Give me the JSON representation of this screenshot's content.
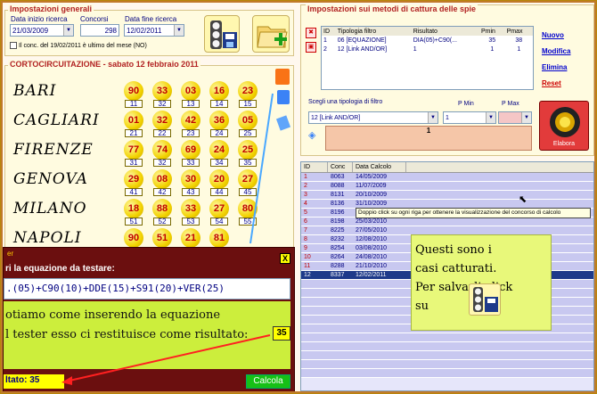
{
  "general": {
    "title": "Impostazioni generali",
    "start_label": "Data inizio ricerca",
    "start_value": "21/03/2009",
    "contest_label": "Concorsi",
    "contest_value": "298",
    "end_label": "Data fine ricerca",
    "end_value": "12/02/2011",
    "checkbox_label": "Il conc. del 19/02/2011 è ultimo del mese (NO)"
  },
  "short_circuit": {
    "title": "CORTOCIRCUITAZIONE - sabato 12 febbraio 2011",
    "rows": [
      {
        "city": "BARI",
        "numbers": [
          "90",
          "33",
          "03",
          "16",
          "23"
        ],
        "boxes": [
          "11",
          "32",
          "13",
          "14",
          "15"
        ]
      },
      {
        "city": "CAGLIARI",
        "numbers": [
          "01",
          "32",
          "42",
          "36",
          "05"
        ],
        "boxes": [
          "21",
          "22",
          "23",
          "24",
          "25"
        ]
      },
      {
        "city": "FIRENZE",
        "numbers": [
          "77",
          "74",
          "69",
          "24",
          "25"
        ],
        "boxes": [
          "31",
          "32",
          "33",
          "34",
          "35"
        ]
      },
      {
        "city": "GENOVA",
        "numbers": [
          "29",
          "08",
          "30",
          "20",
          "27"
        ],
        "boxes": [
          "41",
          "42",
          "43",
          "44",
          "45"
        ]
      },
      {
        "city": "MILANO",
        "numbers": [
          "18",
          "88",
          "33",
          "27",
          "80"
        ],
        "boxes": [
          "51",
          "52",
          "53",
          "54",
          "55"
        ]
      },
      {
        "city": "NAPOLI",
        "numbers": [
          "90",
          "51",
          "21",
          "81",
          ""
        ],
        "boxes": [
          "",
          "",
          "",
          "",
          ""
        ]
      }
    ]
  },
  "spies": {
    "title": "Impostazioni sui metodi di cattura delle spie",
    "columns": [
      "ID",
      "Tipologia filtro",
      "Risultato",
      "Pmin",
      "Pmax"
    ],
    "rows": [
      [
        "1",
        "06 [EQUAZIONE]",
        "DIA(05)+C90(...",
        "35",
        "38"
      ],
      [
        "2",
        "12 [Link AND/OR]",
        "1",
        "1",
        "1"
      ]
    ],
    "links": [
      "Nuovo",
      "Modifica",
      "Elimina",
      "Reset"
    ],
    "filter_label": "Scegli una tipologia di filtro",
    "filter_value": "12 [Link AND/OR]",
    "pmin_label": "P Min",
    "pmin_value": "1",
    "pmax_label": "P Max",
    "result_value": "1",
    "elabora_label": "Elabora"
  },
  "results": {
    "columns": [
      "ID",
      "Conc",
      "Data Calcolo"
    ],
    "rows": [
      [
        "1",
        "8063",
        "14/05/2009"
      ],
      [
        "2",
        "8088",
        "11/07/2009"
      ],
      [
        "3",
        "8131",
        "20/10/2009"
      ],
      [
        "4",
        "8136",
        "31/10/2009"
      ],
      [
        "5",
        "8196",
        ""
      ],
      [
        "6",
        "8198",
        "25/03/2010"
      ],
      [
        "7",
        "8225",
        "27/05/2010"
      ],
      [
        "8",
        "8232",
        "12/08/2010"
      ],
      [
        "9",
        "8254",
        "03/08/2010"
      ],
      [
        "10",
        "8264",
        "24/08/2010"
      ],
      [
        "11",
        "8288",
        "21/10/2010"
      ],
      [
        "12",
        "8337",
        "12/02/2011"
      ]
    ],
    "tooltip": "Doppio click su ogni riga per ottenere la visualizzazione del concorso di calcolo",
    "callout": "Questi sono i casi catturati. Per salvarli click su"
  },
  "tester": {
    "title_fragment": "er",
    "close_label": "X",
    "prompt": "ri la equazione da testare:",
    "equation": ".(05)+C90(10)+DDE(15)+S91(20)+VER(25)",
    "note_line1": "otiamo come inserendo la equazione",
    "note_line2": "l tester esso ci restituisce come risultato:",
    "note_value": "35",
    "result_label": "ltato: 35",
    "calc_label": "Calcola"
  }
}
